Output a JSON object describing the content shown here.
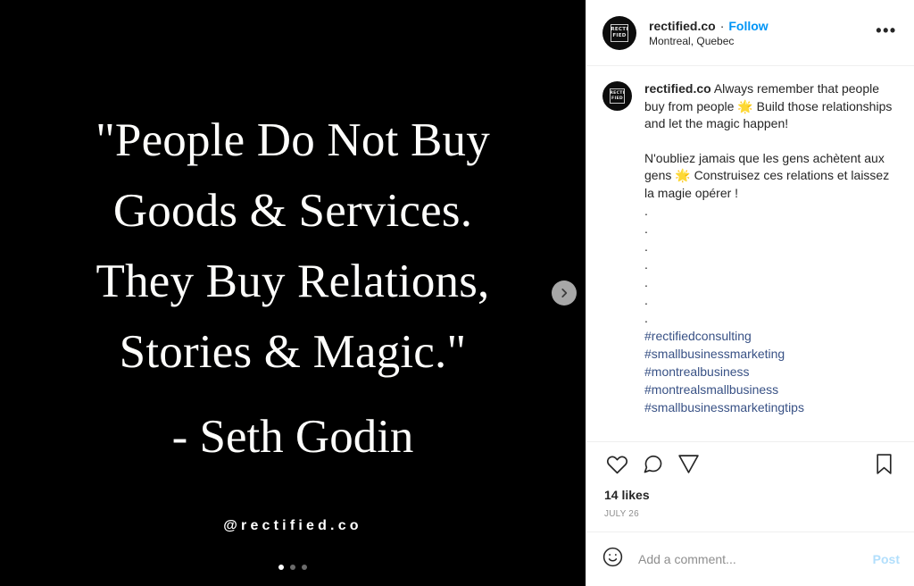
{
  "post": {
    "header": {
      "username": "rectified.co",
      "separator": "·",
      "follow_label": "Follow",
      "location": "Montreal, Quebec",
      "more_options": "•••",
      "avatar_line1": "RECTI",
      "avatar_line2": "FIED"
    },
    "media": {
      "background_color": "#000000",
      "quote_lines": [
        "\"People Do Not Buy",
        "Goods & Services.",
        "They Buy Relations,",
        "Stories & Magic.\""
      ],
      "attribution": "- Seth Godin",
      "handle": "@rectified.co",
      "carousel": {
        "next_icon": "chevron-right-icon",
        "total_slides": 3,
        "active_slide": 1
      }
    },
    "caption": {
      "username": "rectified.co",
      "english_text": " Always remember that people buy from people 🌟 Build those relationships and let the magic happen!",
      "french_text": "N'oubliez jamais que les gens achètent aux gens 🌟 Construisez ces relations et laissez la magie opérer !",
      "spacer_dots": [
        ".",
        ".",
        ".",
        ".",
        ".",
        ".",
        "."
      ],
      "hashtags": [
        "#rectifiedconsulting",
        "#smallbusinessmarketing",
        "#montrealbusiness",
        "#montrealsmallbusiness",
        "#smallbusinessmarketingtips"
      ],
      "hashtag_color": "#385185"
    },
    "actions": {
      "like_icon": "heart-icon",
      "comment_icon": "comment-icon",
      "share_icon": "share-icon",
      "save_icon": "bookmark-icon",
      "likes_count": "14 likes",
      "timestamp": "JULY 26"
    },
    "comment_bar": {
      "emoji_icon": "emoji-smiley-icon",
      "placeholder": "Add a comment...",
      "post_label": "Post",
      "post_color": "#b2dffc"
    },
    "theme": {
      "accent_blue": "#0095f6",
      "text_primary": "#262626",
      "text_muted": "#8e8e8e",
      "divider": "#efefef"
    }
  }
}
